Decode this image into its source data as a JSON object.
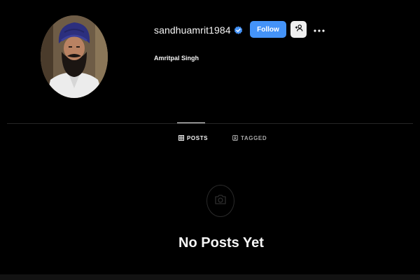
{
  "profile": {
    "username": "sandhuamrit1984",
    "full_name": "Amritpal Singh",
    "verified": true,
    "verified_icon": "verified-badge-icon",
    "avatar_icon": "profile-photo"
  },
  "actions": {
    "follow_label": "Follow",
    "suggest_icon": "add-person-icon",
    "more_icon": "more-horizontal-icon"
  },
  "tabs": [
    {
      "label": "POSTS",
      "icon": "grid-icon",
      "active": true
    },
    {
      "label": "TAGGED",
      "icon": "tag-user-icon",
      "active": false
    }
  ],
  "empty_state": {
    "icon": "camera-icon",
    "title": "No Posts Yet"
  },
  "colors": {
    "background": "#000000",
    "follow_button": "#4493f8",
    "verified_badge": "#4493f8",
    "divider": "#262626",
    "text_primary": "#f5f5f5",
    "text_secondary": "#a8a8a8"
  }
}
